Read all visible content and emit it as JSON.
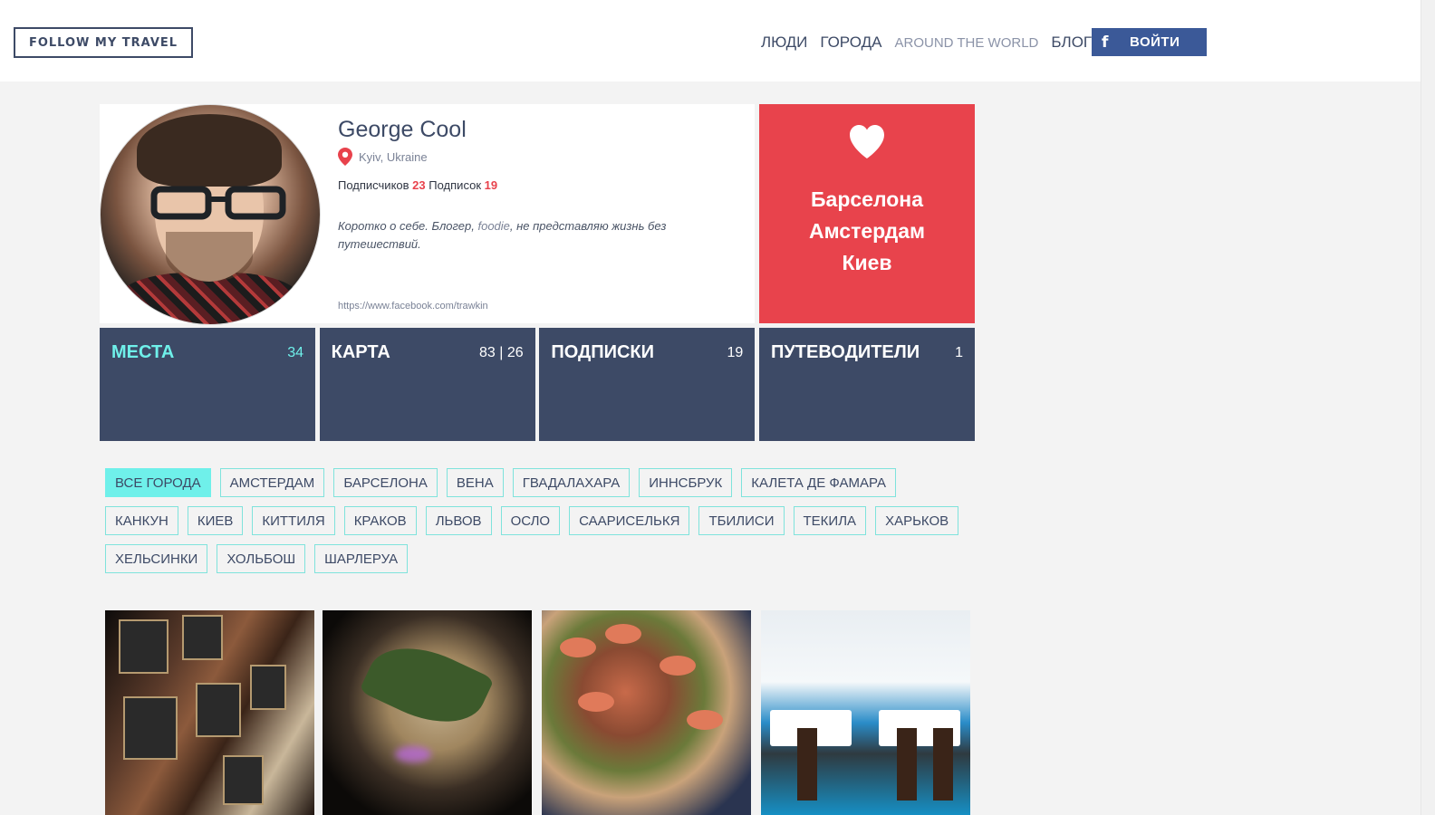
{
  "header": {
    "logo": "FOLLOW MY TRAVEL",
    "nav": [
      "ЛЮДИ",
      "ГОРОДА",
      "AROUND THE WORLD",
      "БЛОГ"
    ],
    "login_label": "ВОЙТИ",
    "login_icon": "facebook-icon",
    "login_color": "#3b5998"
  },
  "profile": {
    "name": "George Cool",
    "location": "Kyiv, Ukraine",
    "followers_label": "Подписчиков",
    "followers_count": "23",
    "following_label": "Подписок",
    "following_count": "19",
    "bio_before": "Коротко о себе. Блогер, ",
    "bio_link": "foodie",
    "bio_after": ", не представляю жизнь без путешествий.",
    "facebook_url": "https://www.facebook.com/trawkin"
  },
  "favorites": {
    "icon": "heart-icon",
    "cities": [
      "Барселона",
      "Амстердам",
      "Киев"
    ],
    "color": "#e8434c"
  },
  "tiles": [
    {
      "label": "МЕСТА",
      "count": "34",
      "active": true
    },
    {
      "label": "КАРТА",
      "count": "83 | 26",
      "active": false
    },
    {
      "label": "ПОДПИСКИ",
      "count": "19",
      "active": false
    },
    {
      "label": "ПУТЕВОДИТЕЛИ",
      "count": "1",
      "active": false
    }
  ],
  "city_filters": {
    "active": "ВСЕ ГОРОДА",
    "rows": [
      [
        "ВСЕ ГОРОДА",
        "АМСТЕРДАМ",
        "БАРСЕЛОНА",
        "ВЕНА",
        "ГВАДАЛАХАРА",
        "ИННСБРУК",
        "КАЛЕТА ДЕ ФАМАРА"
      ],
      [
        "КАНКУН",
        "КИЕВ",
        "КИТТИЛЯ",
        "КРАКОВ",
        "ЛЬВОВ",
        "ОСЛО",
        "СААРИСЕЛЬКЯ",
        "ТБИЛИСИ",
        "ТЕКИЛА",
        "ХАРЬКОВ"
      ],
      [
        "ХЕЛЬСИНКИ",
        "ХОЛЬБОШ",
        "ШАРЛЕРУА"
      ]
    ]
  },
  "colors": {
    "navy": "#3d4a66",
    "accent_cyan": "#6ff0ea",
    "accent_red": "#e8424c"
  }
}
